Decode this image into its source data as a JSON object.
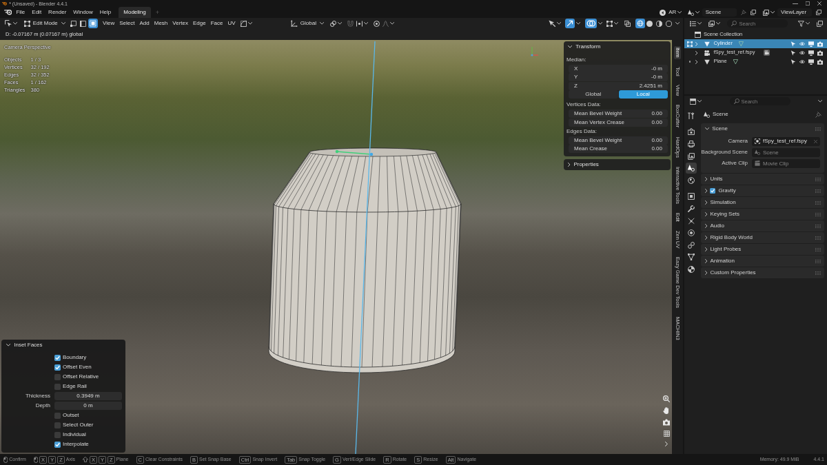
{
  "title_bar": {
    "title": "* (Unsaved) - Blender 4.4.1"
  },
  "menu_bar": {
    "menus": [
      "File",
      "Edit",
      "Render",
      "Window",
      "Help"
    ],
    "workspaces": [
      {
        "label": "Modeling",
        "selected": true
      }
    ],
    "new_workspace": "+",
    "addon_menu": "AR",
    "scene": "Scene",
    "view_layer": "ViewLayer"
  },
  "viewport_header": {
    "mode": "Edit Mode",
    "select_modes": [
      {
        "kind": "vertex",
        "selected": false
      },
      {
        "kind": "edge",
        "selected": false
      },
      {
        "kind": "face",
        "selected": true
      }
    ],
    "menus": [
      "View",
      "Select",
      "Add",
      "Mesh",
      "Vertex",
      "Edge",
      "Face",
      "UV"
    ],
    "orientation": "Global",
    "toggles": [
      {
        "kind": "gizmos",
        "on": true
      },
      {
        "kind": "overlays",
        "on": true
      },
      {
        "kind": "xray",
        "on": false
      }
    ],
    "shading": [
      {
        "kind": "wireframe",
        "selected": true
      },
      {
        "kind": "solid",
        "selected": false
      },
      {
        "kind": "material",
        "selected": false
      },
      {
        "kind": "rendered",
        "selected": false
      }
    ]
  },
  "operator_hint": "D: -0.07167 m (0.07167 m) global",
  "viewport": {
    "view_name": "Camera Perspective",
    "stats": [
      {
        "label": "Objects",
        "value": "1 / 3"
      },
      {
        "label": "Vertices",
        "value": "32 / 192"
      },
      {
        "label": "Edges",
        "value": "32 / 352"
      },
      {
        "label": "Faces",
        "value": "1 / 162"
      },
      {
        "label": "Triangles",
        "value": "380"
      }
    ]
  },
  "sidebar_panels": [
    {
      "title": "Transform",
      "expanded": true,
      "median_label": "Median:",
      "coords": [
        {
          "axis": "X",
          "value": "-0 m"
        },
        {
          "axis": "Y",
          "value": "-0 m"
        },
        {
          "axis": "Z",
          "value": "2.4251 m"
        }
      ],
      "space": [
        {
          "label": "Global",
          "selected": false
        },
        {
          "label": "Local",
          "selected": true
        }
      ],
      "sections": [
        {
          "title": "Vertices Data:",
          "rows": [
            {
              "label": "Mean Bevel Weight",
              "value": "0.00"
            },
            {
              "label": "Mean Vertex Crease",
              "value": "0.00"
            }
          ]
        },
        {
          "title": "Edges Data:",
          "rows": [
            {
              "label": "Mean Bevel Weight",
              "value": "0.00"
            },
            {
              "label": "Mean Crease",
              "value": "0.00"
            }
          ]
        }
      ]
    },
    {
      "title": "Properties",
      "expanded": false
    }
  ],
  "sidebar_tabs": [
    {
      "label": "Item",
      "selected": true
    },
    {
      "label": "Tool",
      "selected": false
    },
    {
      "label": "View",
      "selected": false
    },
    {
      "label": "BoxCutter",
      "selected": false
    },
    {
      "label": "HardOps",
      "selected": false
    },
    {
      "label": "Interactive Tools",
      "selected": false
    },
    {
      "label": "Edit",
      "selected": false
    },
    {
      "label": "Zen UV",
      "selected": false
    },
    {
      "label": "Eazy Game Dev Tools",
      "selected": false
    },
    {
      "label": "MACHIN3",
      "selected": false
    }
  ],
  "operator_panel": {
    "title": "Inset Faces",
    "expanded": true,
    "rows": [
      {
        "kind": "checkbox",
        "label": "Boundary",
        "checked": true
      },
      {
        "kind": "checkbox",
        "label": "Offset Even",
        "checked": true
      },
      {
        "kind": "checkbox",
        "label": "Offset Relative",
        "checked": false
      },
      {
        "kind": "checkbox",
        "label": "Edge Rail",
        "checked": false
      },
      {
        "kind": "number",
        "label": "Thickness",
        "value": "0.3949 m"
      },
      {
        "kind": "number",
        "label": "Depth",
        "value": "0 m"
      },
      {
        "kind": "checkbox",
        "label": "Outset",
        "checked": false
      },
      {
        "kind": "checkbox",
        "label": "Select Outer",
        "checked": false
      },
      {
        "kind": "checkbox",
        "label": "Individual",
        "checked": false
      },
      {
        "kind": "checkbox",
        "label": "Interpolate",
        "checked": true
      }
    ]
  },
  "outliner": {
    "search": {
      "placeholder": "Search"
    },
    "root": "Scene Collection",
    "items": [
      {
        "name": "Cylinder",
        "kind": "mesh",
        "selected": true,
        "expanded": false,
        "edit_mode": true
      },
      {
        "name": "fSpy_test_ref.fspy",
        "kind": "camera",
        "selected": false,
        "expanded": false
      },
      {
        "name": "Plane",
        "kind": "mesh",
        "selected": false,
        "expanded": false,
        "edit_mode": false
      }
    ]
  },
  "properties_editor": {
    "search": {
      "placeholder": "Search"
    },
    "tabs": [
      {
        "kind": "tool",
        "selected": false
      },
      {
        "kind": "render",
        "selected": false
      },
      {
        "kind": "output",
        "selected": false
      },
      {
        "kind": "view_layer",
        "selected": false
      },
      {
        "kind": "scene",
        "selected": true
      },
      {
        "kind": "world",
        "selected": false
      },
      {
        "kind": "object",
        "selected": false
      },
      {
        "kind": "modifiers",
        "selected": false
      },
      {
        "kind": "particles",
        "selected": false
      },
      {
        "kind": "physics",
        "selected": false
      },
      {
        "kind": "constraints",
        "selected": false
      },
      {
        "kind": "data",
        "selected": false
      },
      {
        "kind": "texture",
        "selected": false
      }
    ],
    "context": "Scene",
    "panels": [
      {
        "title": "Scene",
        "kind": "plain",
        "expanded": true,
        "fields": [
          {
            "label": "Camera",
            "kind": "object",
            "value": "fSpy_test_ref.fspy"
          },
          {
            "label": "Background Scene",
            "kind": "scene",
            "placeholder": "Scene"
          },
          {
            "label": "Active Clip",
            "kind": "clip",
            "placeholder": "Movie Clip"
          }
        ]
      },
      {
        "title": "Units",
        "kind": "plain",
        "expanded": false
      },
      {
        "title": "Gravity",
        "kind": "toggle",
        "expanded": false,
        "checked": true
      },
      {
        "title": "Simulation",
        "kind": "plain",
        "expanded": false
      },
      {
        "title": "Keying Sets",
        "kind": "plain",
        "expanded": false
      },
      {
        "title": "Audio",
        "kind": "plain",
        "expanded": false
      },
      {
        "title": "Rigid Body World",
        "kind": "plain",
        "expanded": false
      },
      {
        "title": "Light Probes",
        "kind": "plain",
        "expanded": false
      },
      {
        "title": "Animation",
        "kind": "plain",
        "expanded": false
      },
      {
        "title": "Custom Properties",
        "kind": "plain",
        "expanded": false
      }
    ]
  },
  "status_bar": {
    "hints": [
      {
        "kind": "mouse",
        "label": "Confirm"
      },
      {
        "kind": "mouse",
        "keys": [
          "X",
          "Y",
          "Z"
        ],
        "label": "Axis"
      },
      {
        "kind": "shift",
        "keys": [
          "X",
          "Y",
          "Z"
        ],
        "label": "Plane"
      },
      {
        "kind": "key",
        "keys": [
          "C"
        ],
        "label": "Clear Constraints"
      },
      {
        "kind": "key",
        "keys": [
          "B"
        ],
        "label": "Set Snap Base"
      },
      {
        "kind": "key",
        "keys": [
          "Ctrl"
        ],
        "label": "Snap Invert"
      },
      {
        "kind": "key",
        "keys": [
          "Tab"
        ],
        "label": "Snap Toggle"
      },
      {
        "kind": "key",
        "keys": [
          "G"
        ],
        "label": "Vert/Edge Slide"
      },
      {
        "kind": "key",
        "keys": [
          "R"
        ],
        "label": "Rotate"
      },
      {
        "kind": "key",
        "keys": [
          "S"
        ],
        "label": "Resize"
      },
      {
        "kind": "key",
        "keys": [
          "Alt"
        ],
        "label": "Navigate"
      }
    ],
    "memory": "Memory: 49.9 MiB",
    "version": "4.4.1"
  }
}
